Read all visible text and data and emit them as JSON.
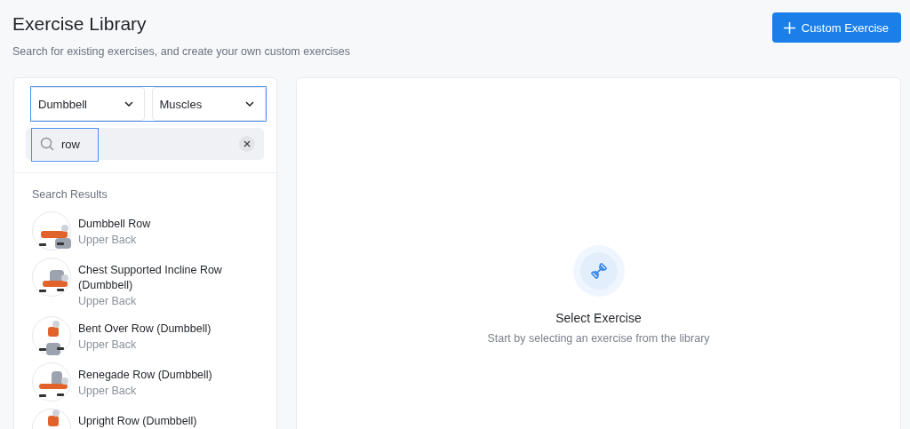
{
  "header": {
    "title": "Exercise Library",
    "subtitle": "Search for existing exercises, and create your own custom exercises",
    "action": {
      "label": "Custom Exercise"
    }
  },
  "filters": [
    {
      "label": "Dumbbell"
    },
    {
      "label": "Muscles"
    }
  ],
  "search": {
    "value": "row"
  },
  "results": {
    "heading": "Search Results",
    "items": [
      {
        "name": "Dumbbell Row",
        "muscle": "Upper Back"
      },
      {
        "name": "Chest Supported Incline Row (Dumbbell)",
        "muscle": "Upper Back"
      },
      {
        "name": "Bent Over Row (Dumbbell)",
        "muscle": "Upper Back"
      },
      {
        "name": "Renegade Row (Dumbbell)",
        "muscle": "Upper Back"
      },
      {
        "name": "Upright Row (Dumbbell)"
      }
    ]
  },
  "empty_state": {
    "title": "Select Exercise",
    "text": "Start by selecting an exercise from the library"
  }
}
